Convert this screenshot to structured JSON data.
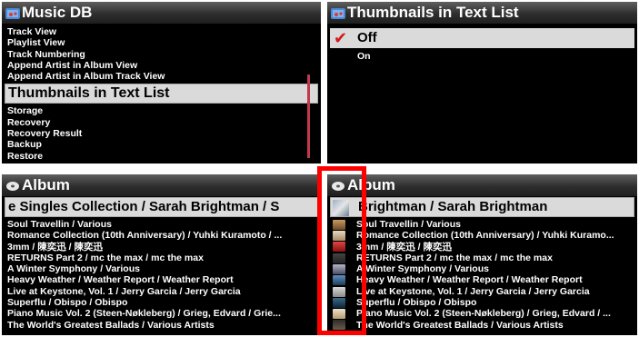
{
  "musicdb": {
    "title": "Music DB",
    "items": [
      "Track View",
      "Playlist View",
      "Track Numbering",
      "Append Artist in Album View",
      "Append Artist in Album Track View"
    ],
    "selected": "Thumbnails in Text List",
    "items_after": [
      "Storage",
      "Recovery",
      "Recovery Result",
      "Backup",
      "Restore"
    ]
  },
  "thumbs": {
    "title": "Thumbnails in Text List",
    "selected": "Off",
    "other": "On"
  },
  "album_left": {
    "title": "Album",
    "selected": "e Singles Collection / Sarah Brightman / S",
    "items": [
      "Soul Travellin / Various",
      "Romance Collection (10th Anniversary) / Yuhki Kuramoto / ...",
      "3mm / 陳奕迅 / 陳奕迅",
      "RETURNS Part 2 / mc the max / mc the max",
      "A Winter Symphony / Various",
      "Heavy Weather / Weather Report / Weather Report",
      "Live at Keystone, Vol. 1 / Jerry Garcia / Jerry Garcia",
      "Superflu / Obispo / Obispo",
      "Piano Music Vol. 2 (Steen-Nøkleberg) / Grieg, Edvard / Grie...",
      "The World's Greatest Ballads / Various Artists"
    ]
  },
  "album_right": {
    "title": "Album",
    "selected": "Brightman / Sarah Brightman",
    "items": [
      "Soul Travellin / Various",
      "Romance Collection (10th Anniversary) / Yuhki Kuramo...",
      "3mm / 陳奕迅 / 陳奕迅",
      "RETURNS Part 2 / mc the max / mc the max",
      "A Winter Symphony / Various",
      "Heavy Weather / Weather Report / Weather Report",
      "Live at Keystone, Vol. 1 / Jerry Garcia / Jerry Garcia",
      "Superflu / Obispo / Obispo",
      "Piano Music Vol. 2 (Steen-Nøkleberg) / Grieg, Edvard / ...",
      "The World's Greatest Ballads / Various Artists"
    ]
  },
  "colors": {
    "accent_red": "#ff0000",
    "selection_bg": "#dadada",
    "check_red": "#d31a1a"
  }
}
